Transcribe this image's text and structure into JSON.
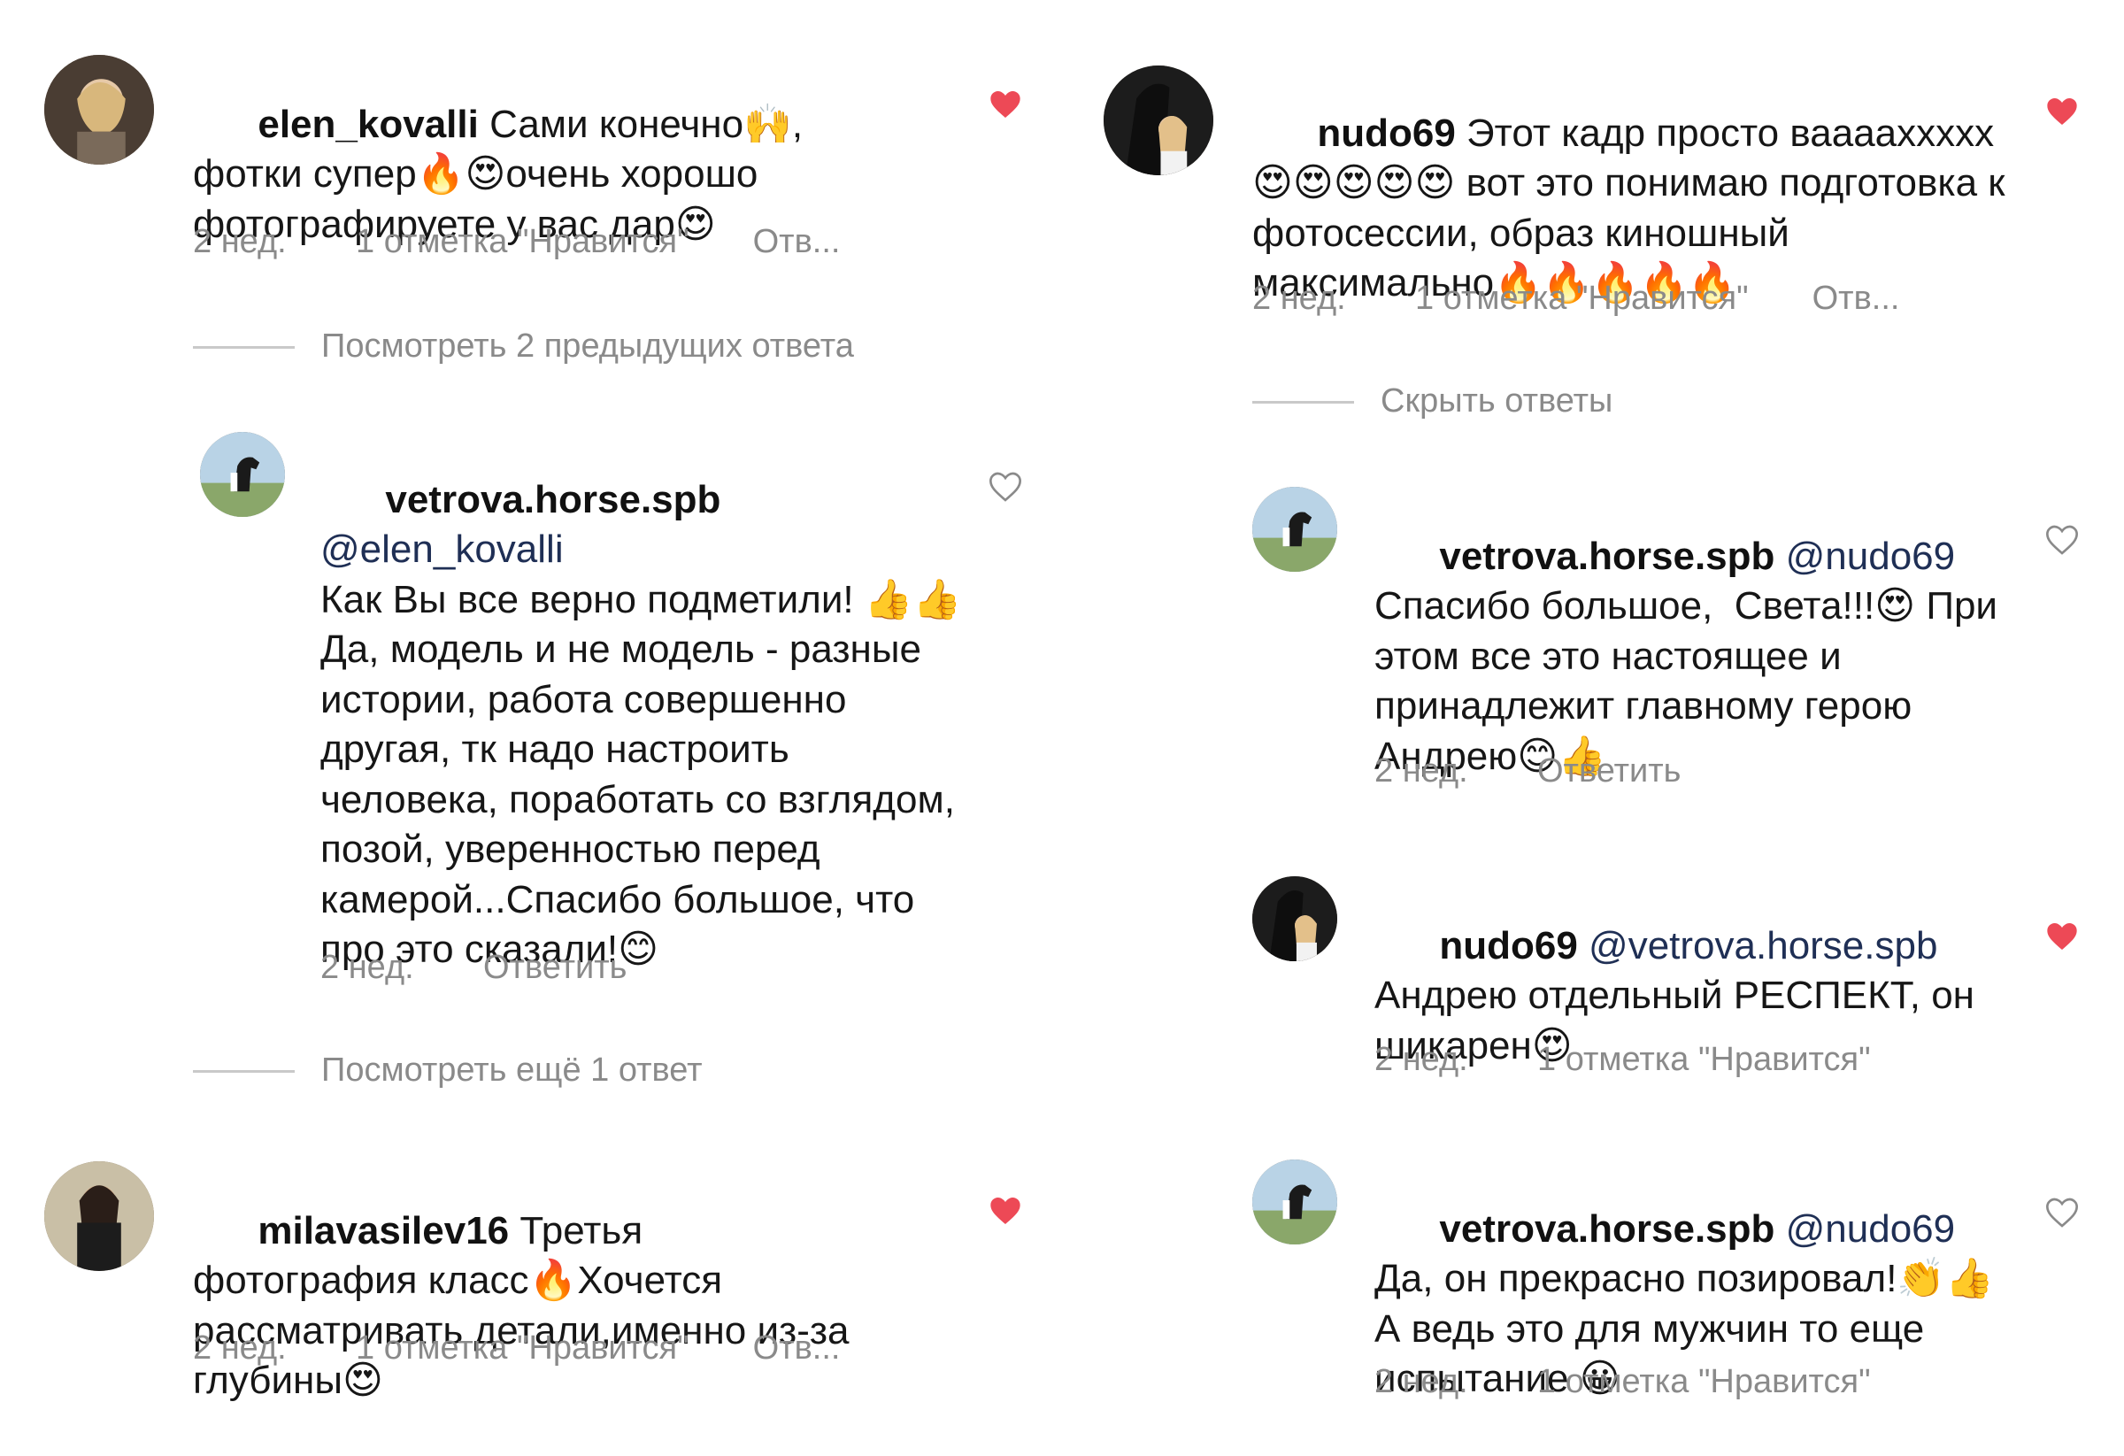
{
  "left": {
    "c1": {
      "username": "elen_kovalli",
      "text": " Сами конечно🙌, фотки супер🔥😍очень хорошо фотографируете у вас дар😍",
      "time": "2 нед.",
      "likes": "1 отметка \"Нравится\"",
      "reply": "Отв...",
      "liked": true
    },
    "toggle1": "Посмотреть 2 предыдущих ответа",
    "r1": {
      "username": "vetrova.horse.spb",
      "mention": " @elen_kovalli",
      "text": "Как Вы все верно подметили! 👍👍 Да, модель и не модель - разные истории, работа совершенно другая, тк надо настроить человека, поработать со взглядом, позой, уверенностью перед камерой...Спасибо большое, что про это сказали!😊",
      "time": "2 нед.",
      "reply": "Ответить",
      "liked": false
    },
    "toggle2": "Посмотреть ещё 1 ответ",
    "c2": {
      "username": "milavasilev16",
      "text": " Третья фотография класс🔥Хочется рассматривать детали,именно из-за глубины😍",
      "time": "2 нед.",
      "likes": "1 отметка \"Нравится\"",
      "reply": "Отв...",
      "liked": true
    }
  },
  "right": {
    "c1": {
      "username": "nudo69",
      "text": " Этот кадр просто вааааххххх 😍😍😍😍😍 вот это понимаю подготовка к фотосессии, образ киношный максимально🔥🔥🔥🔥🔥",
      "time": "2 нед.",
      "likes": "1 отметка \"Нравится\"",
      "reply": "Отв...",
      "liked": true
    },
    "toggle1": "Скрыть ответы",
    "r1": {
      "username": "vetrova.horse.spb",
      "mention": " @nudo69",
      "text": "Спасибо большое,  Света!!!😍 При этом все это настоящее и принадлежит главному герою Андрею😊👍",
      "time": "2 нед.",
      "reply": "Ответить",
      "liked": false
    },
    "r2": {
      "username": "nudo69",
      "mention": " @vetrova.horse.spb",
      "text": "Андрею отдельный РЕСПЕКТ, он шикарен😍",
      "time": "2 нед.",
      "likes": "1 отметка \"Нравится\"",
      "liked": true
    },
    "r3": {
      "username": "vetrova.horse.spb",
      "mention": " @nudo69",
      "text": " Да, он прекрасно позировал!👏👍 А ведь это для мужчин то еще испытание 😀",
      "time": "2 нед.",
      "likes": "1 отметка \"Нравится\"",
      "liked": false
    }
  },
  "icons": {
    "like_filled": "heart-filled-icon",
    "like_outline": "heart-outline-icon"
  },
  "colors": {
    "heart_red": "#ed4956",
    "meta_gray": "#8a8a8a",
    "mention_blue": "#1f2f55"
  }
}
